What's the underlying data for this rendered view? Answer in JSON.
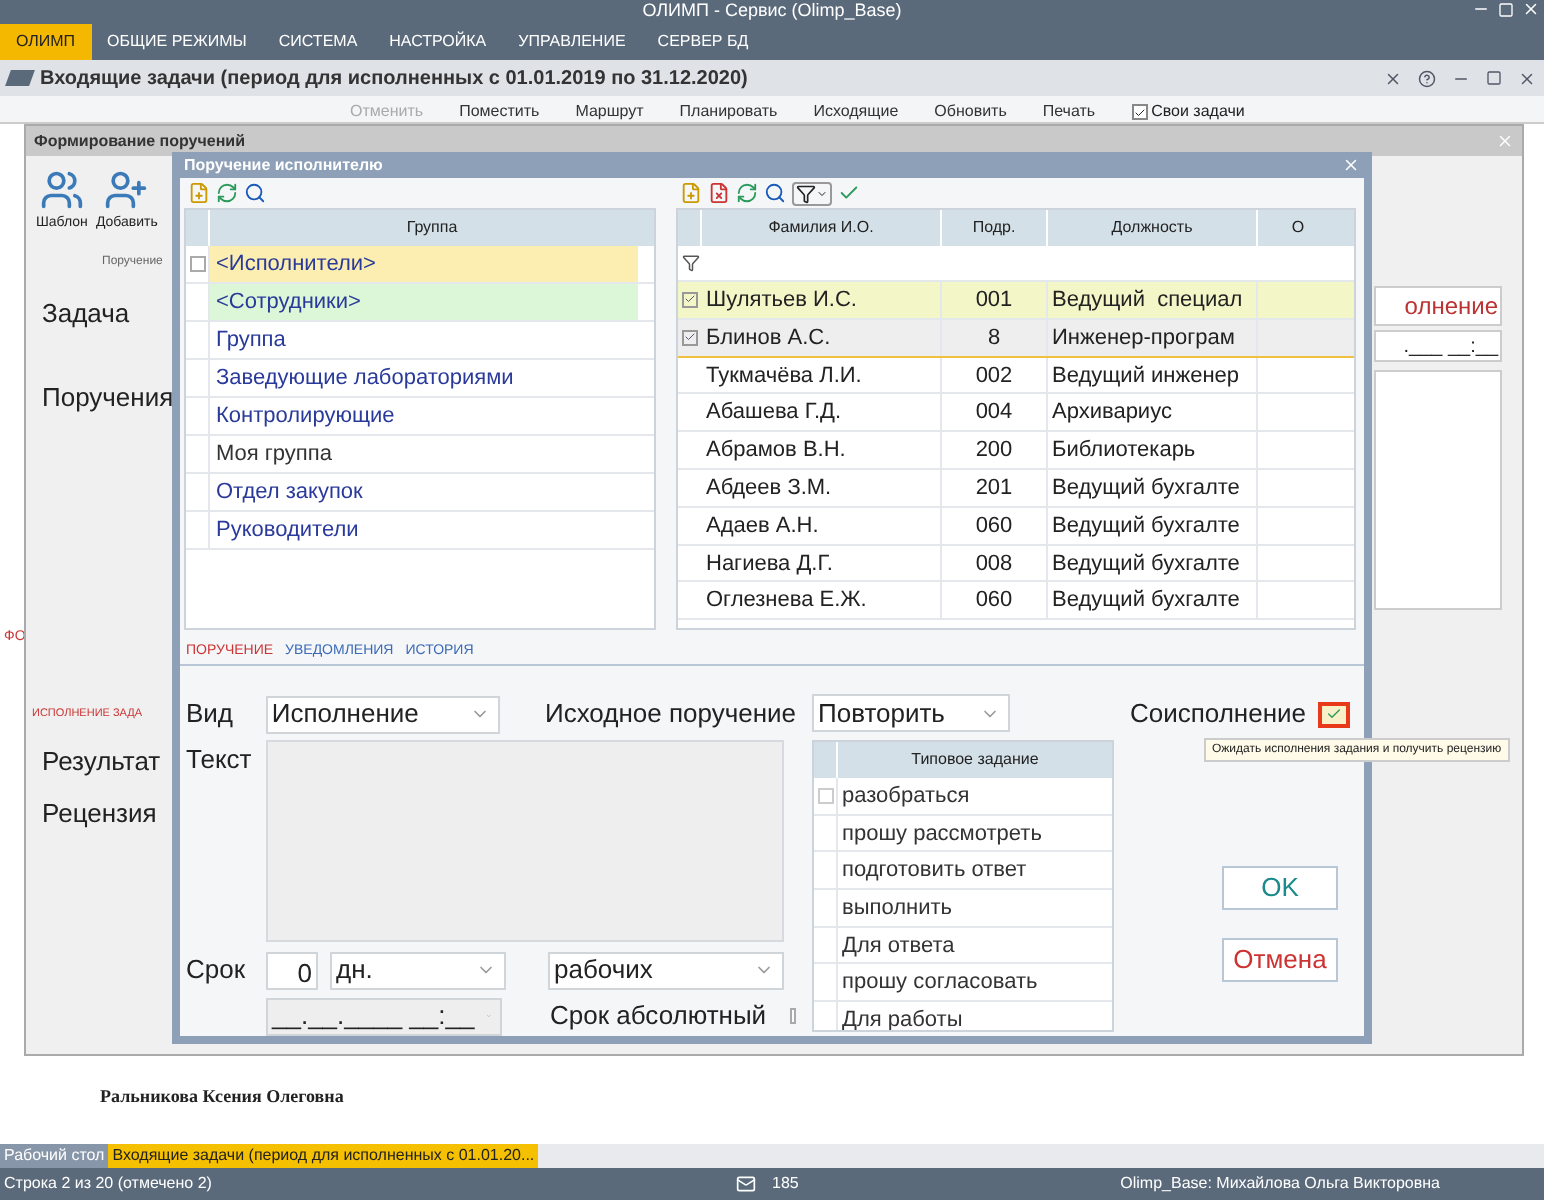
{
  "app": {
    "title": "ОЛИМП - Сервис (Olimp_Base)",
    "menu": [
      {
        "label": "ОЛИМП",
        "selected": true
      },
      {
        "label": "ОБЩИЕ РЕЖИМЫ",
        "selected": false
      },
      {
        "label": "СИСТЕМА",
        "selected": false
      },
      {
        "label": "НАСТРОЙКА",
        "selected": false
      },
      {
        "label": "УПРАВЛЕНИЕ",
        "selected": false
      },
      {
        "label": "СЕРВЕР БД",
        "selected": false
      }
    ]
  },
  "document": {
    "title": "Входящие задачи (период для исполненных с 01.01.2019 по 31.12.2020)",
    "toolbar": [
      {
        "label": "Отменить",
        "disabled": true
      },
      {
        "label": "Поместить",
        "disabled": false
      },
      {
        "label": "Маршрут",
        "disabled": false
      },
      {
        "label": "Планировать",
        "disabled": false
      },
      {
        "label": "Исходящие",
        "disabled": false
      },
      {
        "label": "Обновить",
        "disabled": false
      },
      {
        "label": "Печать",
        "disabled": false
      }
    ],
    "own_tasks": {
      "label": "Свои задачи",
      "checked": true
    },
    "side_tab": "ФО",
    "person": "Ральникова Ксения Олеговна"
  },
  "outer_dialog": {
    "title": "Формирование поручений",
    "ribbon": [
      "Шаблон",
      "Добавить"
    ],
    "ribbon_group": "Поручение",
    "labels": [
      "Задача",
      "Поручения"
    ],
    "kind_value": "олнение",
    "date": ".___ __:__",
    "tab": "ИСПОЛНЕНИЕ ЗАДА",
    "labels2": [
      "Результат",
      "Рецензия"
    ]
  },
  "inner_dialog": {
    "title": "Поручение исполнителю",
    "groups": {
      "column": "Группа",
      "checkbox_checked": false,
      "rows": [
        {
          "name": "<Исполнители>",
          "kind": "system",
          "selected": true
        },
        {
          "name": "<Сотрудники>",
          "kind": "system",
          "selected": false
        },
        {
          "name": "Группа",
          "kind": "group",
          "selected": false
        },
        {
          "name": "Заведующие лабораториями",
          "kind": "group",
          "selected": false
        },
        {
          "name": "Контролирующие",
          "kind": "group",
          "selected": false
        },
        {
          "name": "Моя группа",
          "kind": "personal",
          "selected": false
        },
        {
          "name": "Отдел закупок",
          "kind": "group",
          "selected": false
        },
        {
          "name": "Руководители",
          "kind": "group",
          "selected": false
        }
      ]
    },
    "employees": {
      "columns": [
        "Фамилия И.О.",
        "Подр.",
        "Должность",
        "О"
      ],
      "rows": [
        {
          "name": "Шулятьев И.С.",
          "dept": "001",
          "position": "Ведущий  специал",
          "checked": true,
          "selected": true,
          "current": false
        },
        {
          "name": "Блинов А.С.",
          "dept": "8",
          "position": "Инженер-програм",
          "checked": true,
          "selected": false,
          "current": true
        },
        {
          "name": "Тукмачёва Л.И.",
          "dept": "002",
          "position": "Ведущий инженер",
          "checked": false,
          "selected": false,
          "current": false
        },
        {
          "name": "Абашева Г.Д.",
          "dept": "004",
          "position": "Архивариус",
          "checked": false,
          "selected": false,
          "current": false
        },
        {
          "name": "Абрамов В.Н.",
          "dept": "200",
          "position": "Библиотекарь",
          "checked": false,
          "selected": false,
          "current": false
        },
        {
          "name": "Абдеев З.М.",
          "dept": "201",
          "position": "Ведущий бухгалте",
          "checked": false,
          "selected": false,
          "current": false
        },
        {
          "name": "Адаев А.Н.",
          "dept": "060",
          "position": "Ведущий бухгалте",
          "checked": false,
          "selected": false,
          "current": false
        },
        {
          "name": "Нагиева Д.Г.",
          "dept": "008",
          "position": "Ведущий бухгалте",
          "checked": false,
          "selected": false,
          "current": false
        },
        {
          "name": "Оглезнева Е.Ж.",
          "dept": "060",
          "position": "Ведущий бухгалте",
          "checked": false,
          "selected": false,
          "current": false
        }
      ]
    },
    "tabs": [
      {
        "label": "ПОРУЧЕНИЕ",
        "selected": true
      },
      {
        "label": "УВЕДОМЛЕНИЯ",
        "selected": false
      },
      {
        "label": "ИСТОРИЯ",
        "selected": false
      }
    ],
    "form": {
      "kind_label": "Вид",
      "kind_value": "Исполнение",
      "source_label": "Исходное поручение",
      "source_value": "Повторить",
      "co_label": "Соисполнение",
      "co_checked": true,
      "text_label": "Текст",
      "term_label": "Срок",
      "term_value": "0",
      "term_unit": "дн.",
      "term_days": "рабочих",
      "date": "__.__.____ __:__",
      "absolute_label": "Срок абсолютный",
      "absolute_checked": false
    },
    "tasks": {
      "column": "Типовое задание",
      "checkbox_checked": false,
      "rows": [
        {
          "text": "разобраться"
        },
        {
          "text": "прошу рассмотреть"
        },
        {
          "text": "подготовить ответ"
        },
        {
          "text": "выполнить"
        },
        {
          "text": "Для ответа"
        },
        {
          "text": "прошу согласовать"
        },
        {
          "text": "Для работы"
        }
      ]
    },
    "buttons": [
      "OK",
      "Отмена"
    ]
  },
  "tooltip": "Ожидать исполнения задания и получить рецензию",
  "status": {
    "tabs": [
      {
        "label": "Рабочий стол",
        "selected": false
      },
      {
        "label": "Входящие задачи (период для исполненных с 01.01.20...",
        "selected": true
      }
    ],
    "row_info": "Строка 2 из 20 (отмечено 2)",
    "mail_count": "185",
    "user": "Olimp_Base: Михайлова Ольга Викторовна"
  }
}
